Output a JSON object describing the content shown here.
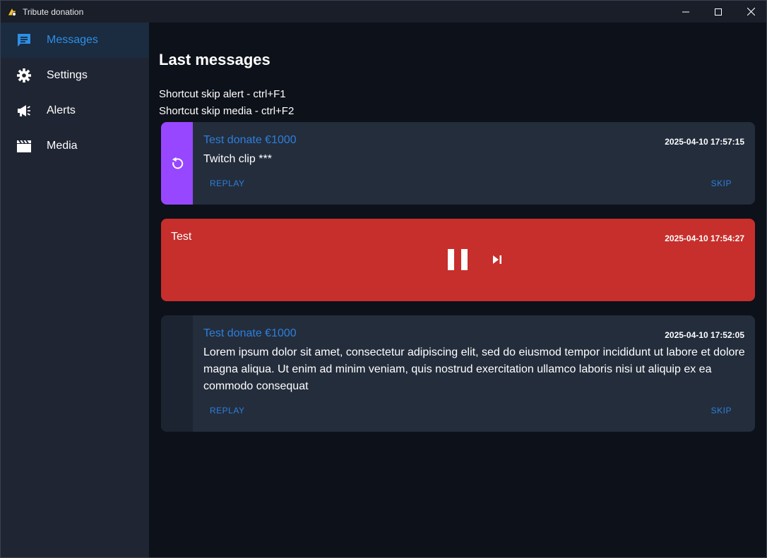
{
  "window": {
    "title": "Tribute donation",
    "controls": {
      "minimize": "minimize-icon",
      "maximize": "maximize-icon",
      "close": "close-icon"
    }
  },
  "sidebar": {
    "items": [
      {
        "label": "Messages",
        "icon": "chat-icon",
        "active": true
      },
      {
        "label": "Settings",
        "icon": "gear-icon",
        "active": false
      },
      {
        "label": "Alerts",
        "icon": "megaphone-icon",
        "active": false
      },
      {
        "label": "Media",
        "icon": "clapperboard-icon",
        "active": false
      }
    ]
  },
  "main": {
    "title": "Last messages",
    "shortcuts": [
      "Shortcut skip alert - ctrl+F1",
      "Shortcut skip media - ctrl+F2"
    ],
    "messages": [
      {
        "title": "Test donate €1000",
        "time": "2025-04-10 17:57:15",
        "text": "Twitch clip ***",
        "replay_label": "REPLAY",
        "skip_label": "SKIP",
        "strip_icon": "replay-icon"
      },
      {
        "title": "Test",
        "time": "2025-04-10 17:54:27",
        "controls": {
          "pause": "pause-icon",
          "next": "skip-next-icon"
        }
      },
      {
        "title": "Test donate €1000",
        "time": "2025-04-10 17:52:05",
        "text": "Lorem ipsum dolor sit amet, consectetur adipiscing elit, sed do eiusmod tempor incididunt ut labore et dolore magna aliqua. Ut enim ad minim veniam, quis nostrud exercitation ullamco laboris nisi ut aliquip ex ea commodo consequat",
        "replay_label": "REPLAY",
        "skip_label": "SKIP"
      }
    ]
  },
  "colors": {
    "accent": "#2d8fe6",
    "purple": "#9747ff",
    "active_card": "#c62f2c",
    "card_bg": "#242d3c",
    "sidebar_bg": "#1f2532",
    "main_bg": "#0d1119"
  }
}
